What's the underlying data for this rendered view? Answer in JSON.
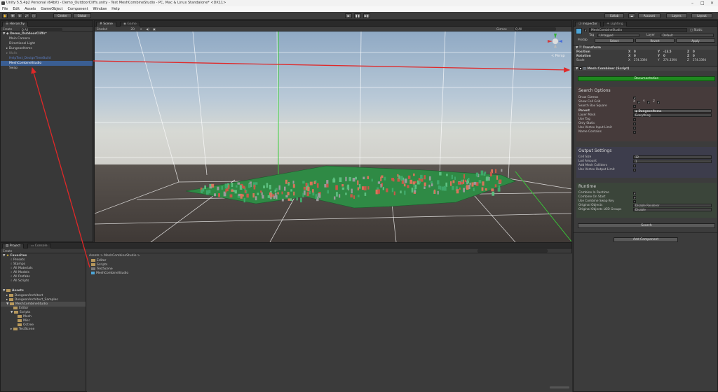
{
  "window": {
    "title": "Unity 5.5.4p2 Personal (64bit) - Demo_OutdoorCliffs.unity - Test MeshCombineStudio - PC, Mac & Linux Standalone* <DX11>"
  },
  "menu": [
    "File",
    "Edit",
    "Assets",
    "GameObject",
    "Component",
    "Window",
    "Help"
  ],
  "toolbar": {
    "pivot_label": "Center",
    "space_label": "Global",
    "collab_label": "Collab",
    "account_label": "Account",
    "layers_label": "Layers",
    "layout_label": "Layout"
  },
  "hierarchy": {
    "tab": "Hierarchy",
    "create": "Create",
    "search": "Q All",
    "scene": "Demo_OutdoorCliffs*",
    "items": [
      "Main Camera",
      "Directional Light",
      "DungeonItems",
      "Walls",
      "HelpText_DesignTimeBuild",
      "MeshCombineStudio",
      "Swap"
    ]
  },
  "scene": {
    "tab_scene": "Scene",
    "tab_game": "Game",
    "shading": "Shaded",
    "mode_2d": "2D",
    "gizmos": "Gizmos",
    "search": "Q All",
    "persp_label": "< Persp"
  },
  "inspector": {
    "tab_inspector": "Inspector",
    "tab_lighting": "Lighting",
    "object_name": "MeshCombineStudio",
    "static_label": "Static",
    "tag_label": "Tag",
    "tag_value": "Untagged",
    "layer_label": "Layer",
    "layer_value": "Default",
    "prefab_label": "Prefab",
    "prefab_select": "Select",
    "prefab_revert": "Revert",
    "prefab_apply": "Apply",
    "transform_title": "Transform",
    "position_label": "Position",
    "rotation_label": "Rotation",
    "scale_label": "Scale",
    "pos": [
      "0",
      "-13.5",
      "0"
    ],
    "rot": [
      "0",
      "0",
      "0"
    ],
    "scale": [
      "274.3394",
      "274.3394",
      "274.3394"
    ],
    "component_title": "Mesh Combiner (Script)",
    "documentation_button": "Documentation",
    "search_options": {
      "title": "Search Options",
      "draw_gizmos": "Draw Gizmos",
      "show_cell_grid": "Show Cell Grid",
      "search_box_square": "Search Box Square",
      "parent": "Parent",
      "parent_value": "DungeonItems",
      "layer_mask": "Layer Mask",
      "layer_mask_value": "Everything",
      "use_tag": "Use Tag",
      "only_static": "Only Static",
      "use_vertex_input_limit": "Use Vertex Input Limit",
      "name_contains": "Name Contains"
    },
    "output_settings": {
      "title": "Output Settings",
      "cell_size": "Cell Size",
      "cell_size_value": "32",
      "lod_amount": "Lod Amount",
      "lod_amount_value": "1",
      "add_mesh_colliders": "Add Mesh Colliders",
      "use_vertex_output_limit": "Use Vertex Output Limit"
    },
    "runtime": {
      "title": "Runtime",
      "combine_in_runtime": "Combine In Runtime",
      "combine_on_start": "Combine On Start",
      "use_combine_swap_key": "Use Combine Swap Key",
      "original_objects": "Original Objects",
      "original_objects_value": "Disable Renderer",
      "original_objects_lod_groups": "Original Objects LOD Groups",
      "original_objects_lod_groups_value": "Disable"
    },
    "search_button": "Search",
    "add_component_button": "Add Component"
  },
  "project": {
    "tab_project": "Project",
    "tab_console": "Console",
    "create": "Create",
    "favorites_title": "Favorites",
    "favorites": [
      "Presets",
      "Stamps",
      "All Materials",
      "All Models",
      "All Prefabs",
      "All Scripts"
    ],
    "assets_title": "Assets",
    "tree": [
      "DungeonArchitect",
      "DungeonArchitect_Samples",
      "MeshCombineStudio",
      "Editor",
      "Scripts",
      "Mesh",
      "Misc",
      "Octree",
      "TestScene"
    ],
    "breadcrumb": "Assets > MeshCombineStudio >",
    "files": [
      "Editor",
      "Scripts",
      "TestScene",
      "MeshCombineStudio"
    ]
  },
  "colors": {
    "accent_selection": "#3a5e93",
    "annotation_arrow": "#e02828",
    "documentation_green": "#1f8a1f",
    "search_section_tint": "#4a3a3a",
    "output_section_tint": "#3a3a4a",
    "runtime_section_tint": "#3a4438"
  }
}
